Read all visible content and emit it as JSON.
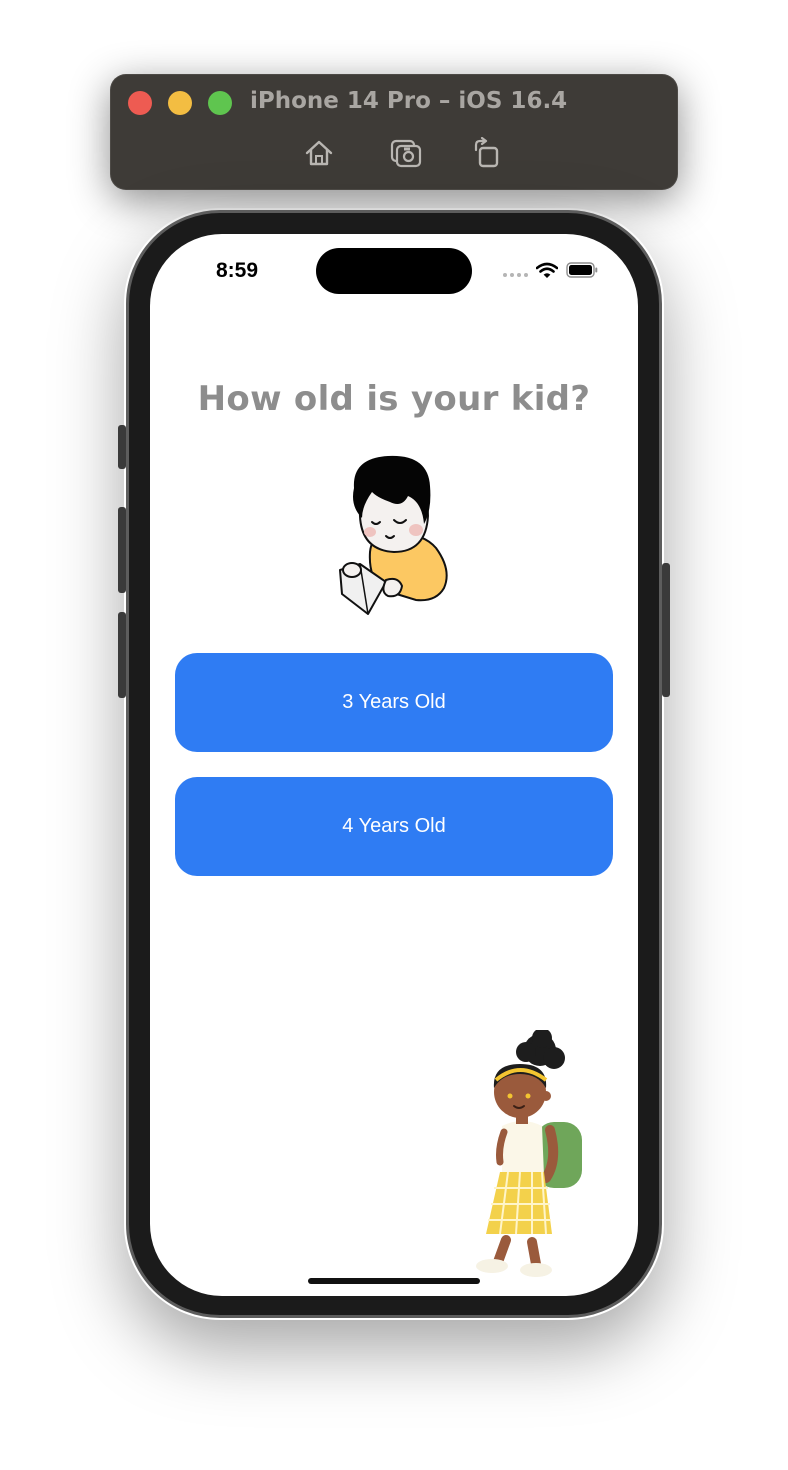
{
  "simulator": {
    "title": "iPhone 14 Pro – iOS 16.4",
    "toolbar": [
      "home-icon",
      "screenshot-icon",
      "rotate-icon"
    ]
  },
  "status_bar": {
    "time": "8:59"
  },
  "screen": {
    "question": "How old is your kid?",
    "options": [
      {
        "label": "3 Years Old"
      },
      {
        "label": "4 Years Old"
      }
    ]
  },
  "colors": {
    "button": "#2f7cf3",
    "question_text": "#8d8d8d",
    "sim_bar": "#3e3b37"
  }
}
